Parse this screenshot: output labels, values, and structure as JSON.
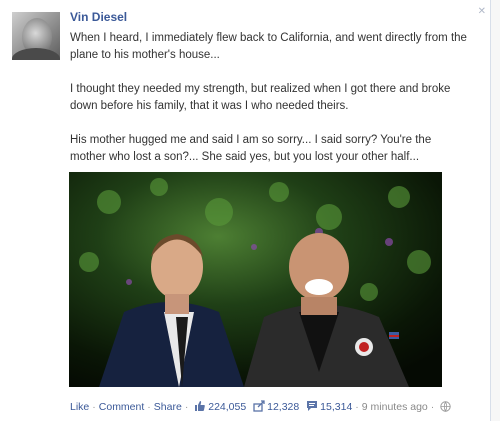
{
  "post": {
    "author": "Vin Diesel",
    "paragraphs": [
      "When I heard, I immediately flew back to California, and went directly from the plane to his mother's house...",
      "I thought they needed my strength, but realized when I got there and broke down before his family, that it was I who needed theirs.",
      "His mother hugged me and said I am so sorry... I said sorry? You're the mother who lost a son?... She said yes, but you lost your other half..."
    ]
  },
  "footer": {
    "like": "Like",
    "comment": "Comment",
    "share": "Share",
    "likes_count": "224,055",
    "shares_count": "12,328",
    "comments_count": "15,314",
    "timestamp": "9 minutes ago"
  },
  "icons": {
    "thumbs_up": "thumbs-up-icon",
    "share": "share-icon",
    "comment": "comment-bubble-icon",
    "globe": "globe-icon"
  },
  "colors": {
    "link": "#3b5998",
    "meta": "#8a8a8a"
  }
}
